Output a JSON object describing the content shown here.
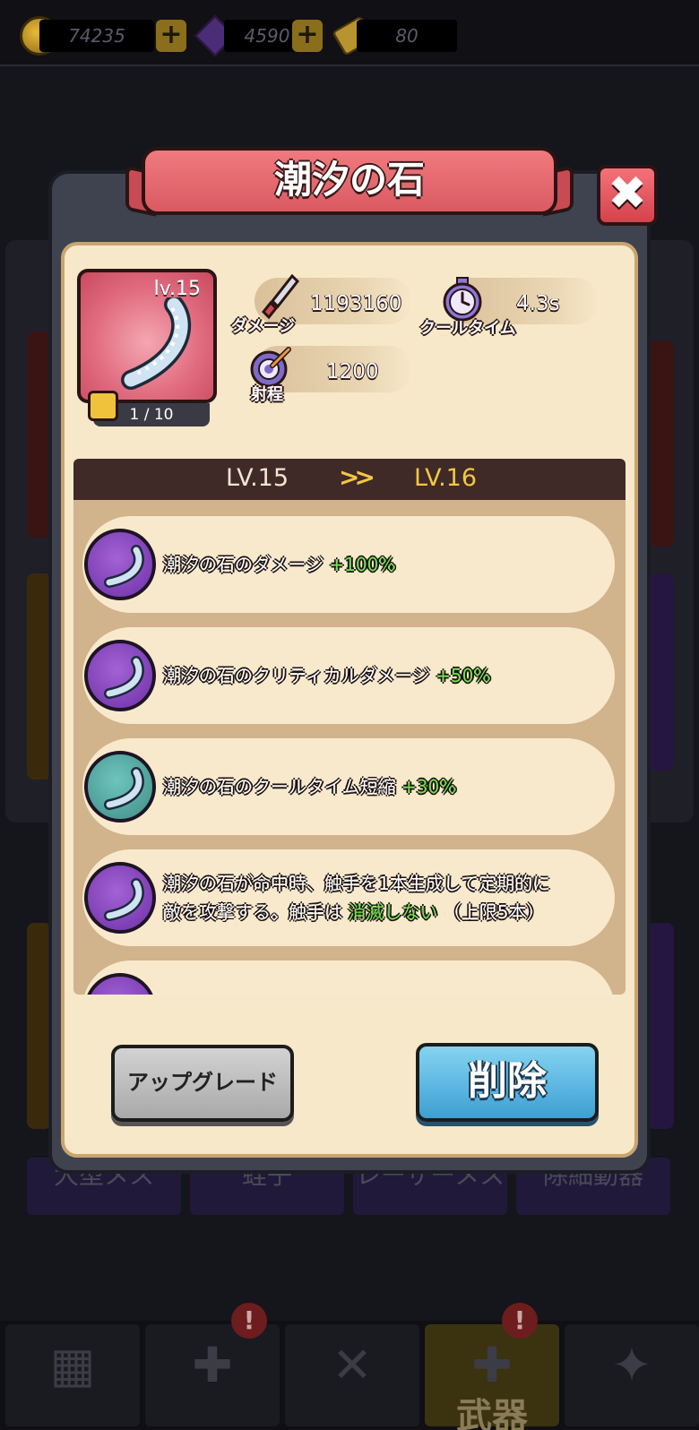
{
  "resources": {
    "coins": "74235",
    "gems": "4590",
    "tickets": "80",
    "plus_glyph": "+"
  },
  "background": {
    "tabs": [
      "大型メス",
      "蛭子",
      "レーザーメス",
      "除細動器"
    ],
    "nav": [
      {
        "icon": "shop-icon",
        "label": ""
      },
      {
        "icon": "brain-nurse-icon",
        "label": "",
        "badge": "!"
      },
      {
        "icon": "syringe-icon",
        "label": ""
      },
      {
        "icon": "medkit-icon",
        "label": "武器",
        "badge": "!"
      },
      {
        "icon": "emblem-icon",
        "label": ""
      }
    ]
  },
  "modal": {
    "title": "潮汐の石",
    "close_glyph": "✖",
    "item": {
      "level": "lv.15",
      "shards": "1 / 10"
    },
    "stats": {
      "damage_label": "ダメージ",
      "damage_value": "1193160",
      "cooldown_label": "クールタイム",
      "cooldown_value": "4.3s",
      "range_label": "射程",
      "range_value": "1200"
    },
    "level_header": {
      "from": "LV.15",
      "arrow": "»",
      "to": "LV.16"
    },
    "perks": [
      {
        "text": "潮汐の石のダメージ",
        "bonus": "+100%",
        "color": "purple"
      },
      {
        "text": "潮汐の石のクリティカルダメージ",
        "bonus": "+50%",
        "color": "purple"
      },
      {
        "text": "潮汐の石のクールタイム短縮",
        "bonus": "+30%",
        "color": "teal"
      },
      {
        "line1": "潮汐の石が命中時、触手を1本生成して定期的に",
        "line2_pre": "敵を攻撃する。触手は",
        "line2_highlight": "消滅しない",
        "line2_post": "（上限5本）",
        "color": "purple"
      }
    ],
    "buttons": {
      "upgrade": "アップグレード",
      "delete": "削除"
    },
    "colors": {
      "ribbon": "#e0636b",
      "panel": "#f7e8c9",
      "perk_green": "#6fe44a",
      "lv_gold": "#f3c742",
      "delete_blue": "#5cb7e2"
    }
  }
}
